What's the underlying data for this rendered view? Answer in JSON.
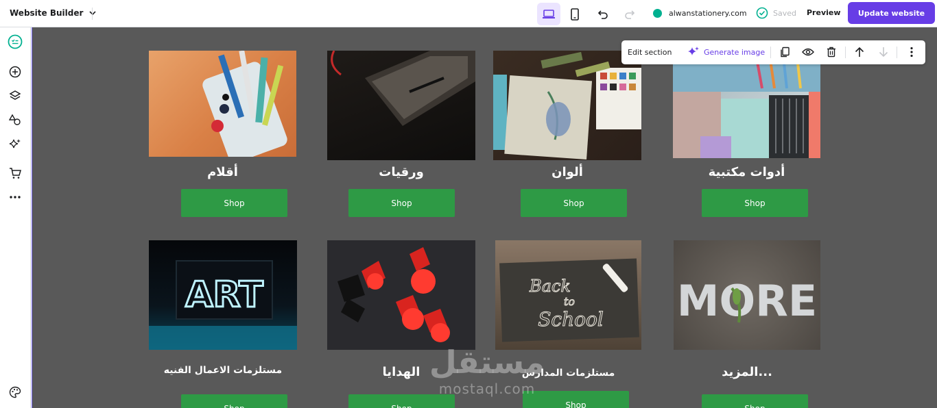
{
  "topbar": {
    "brand": "Website Builder",
    "domain": "alwanstationery.com",
    "saved_label": "Saved",
    "preview_label": "Preview",
    "update_label": "Update website"
  },
  "edit_bar": {
    "edit_section_label": "Edit section",
    "generate_image_label": "Generate image"
  },
  "products": [
    {
      "title": "أقلام",
      "button": "Shop"
    },
    {
      "title": "ورقيات",
      "button": "Shop"
    },
    {
      "title": "ألوان",
      "button": "Shop"
    },
    {
      "title": "أدوات مكتبية",
      "button": "Shop"
    },
    {
      "title": "مستلزمات الاعمال الفنيه",
      "button": "Shop"
    },
    {
      "title": "الهدايا",
      "button": "Shop"
    },
    {
      "title": "مستلزمات المدارس",
      "button": "Shop"
    },
    {
      "title": "المزيد...",
      "button": "Shop"
    }
  ],
  "images": {
    "art_text": "ART",
    "back_to_school_line1": "Back",
    "back_to_school_line2": "to",
    "back_to_school_line3": "School",
    "more_text": "MORE"
  },
  "watermark": {
    "arabic": "مستقل",
    "latin": "mostaql.com"
  },
  "colors": {
    "accent": "#673de6",
    "shop_green": "#2e9a45",
    "canvas_bg": "#595959",
    "domain_dot": "#00b090"
  }
}
